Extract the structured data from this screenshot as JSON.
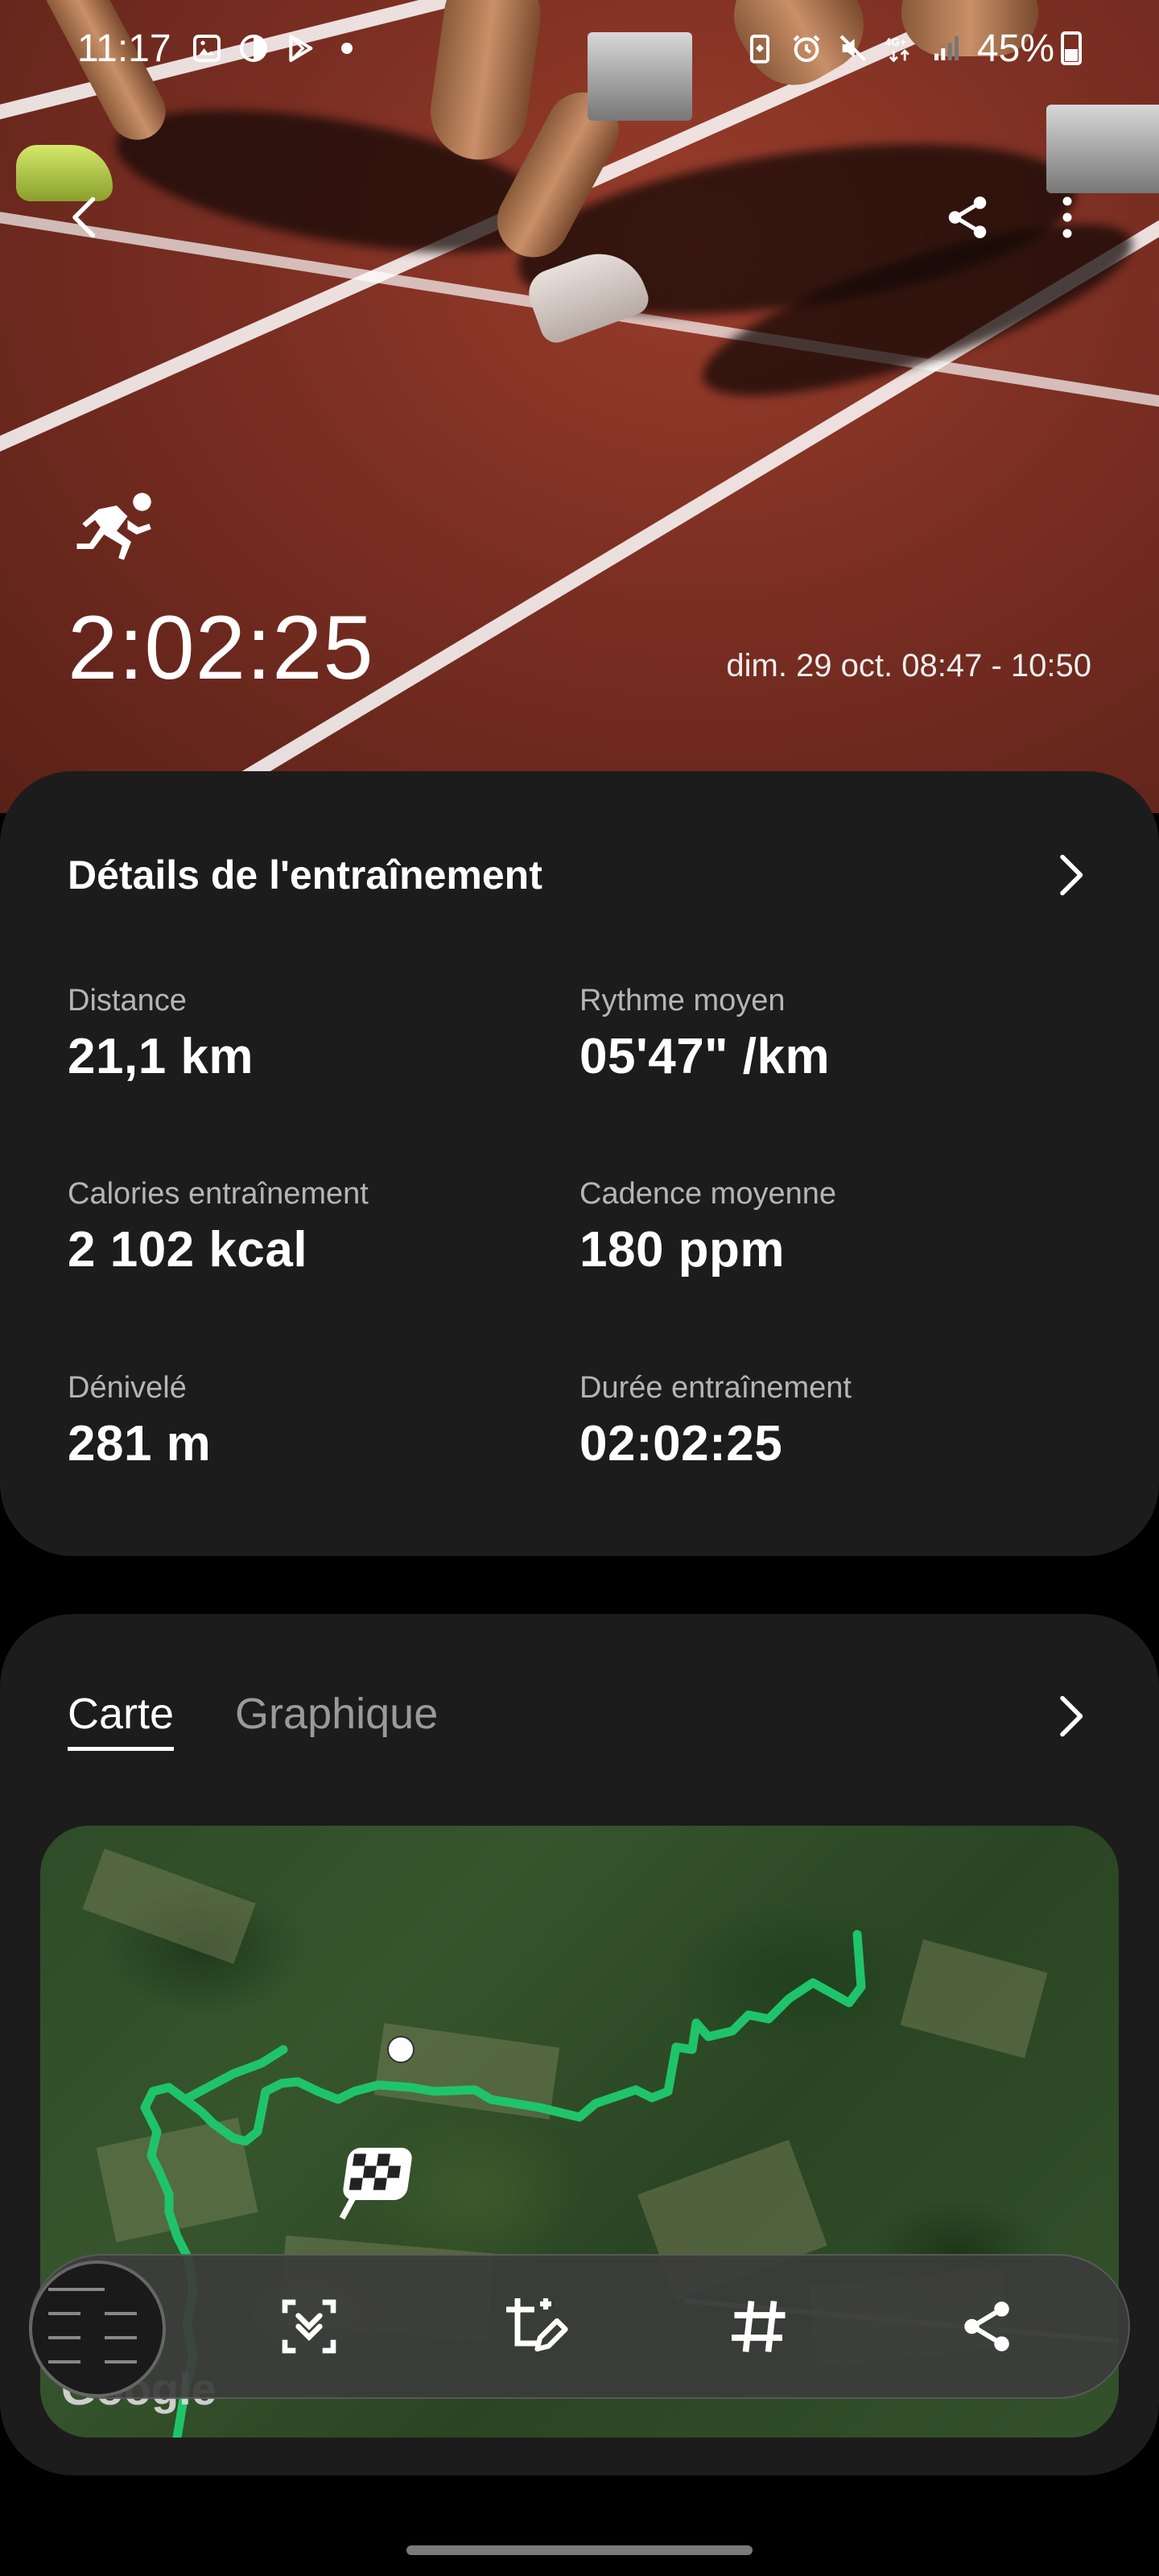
{
  "status_bar": {
    "time": "11:17",
    "battery": "45%"
  },
  "hero": {
    "activity_icon": "running-icon",
    "total_time": "2:02:25",
    "date_range": "dim. 29 oct. 08:47 - 10:50"
  },
  "details": {
    "title": "Détails de l'entraînement",
    "stats": [
      {
        "label": "Distance",
        "value": "21,1 km"
      },
      {
        "label": "Rythme moyen",
        "value": "05'47\" /km"
      },
      {
        "label": "Calories entraînement",
        "value": "2 102 kcal"
      },
      {
        "label": "Cadence moyenne",
        "value": "180 ppm"
      },
      {
        "label": "Dénivelé",
        "value": "281 m"
      },
      {
        "label": "Durée entraînement",
        "value": "02:02:25"
      }
    ]
  },
  "map_card": {
    "tabs": [
      {
        "label": "Carte",
        "active": true
      },
      {
        "label": "Graphique",
        "active": false
      }
    ],
    "attribution": "Google"
  },
  "colors": {
    "route": "#1fc46a",
    "card_bg": "#1c1c1c",
    "track": "#7a2e22"
  }
}
